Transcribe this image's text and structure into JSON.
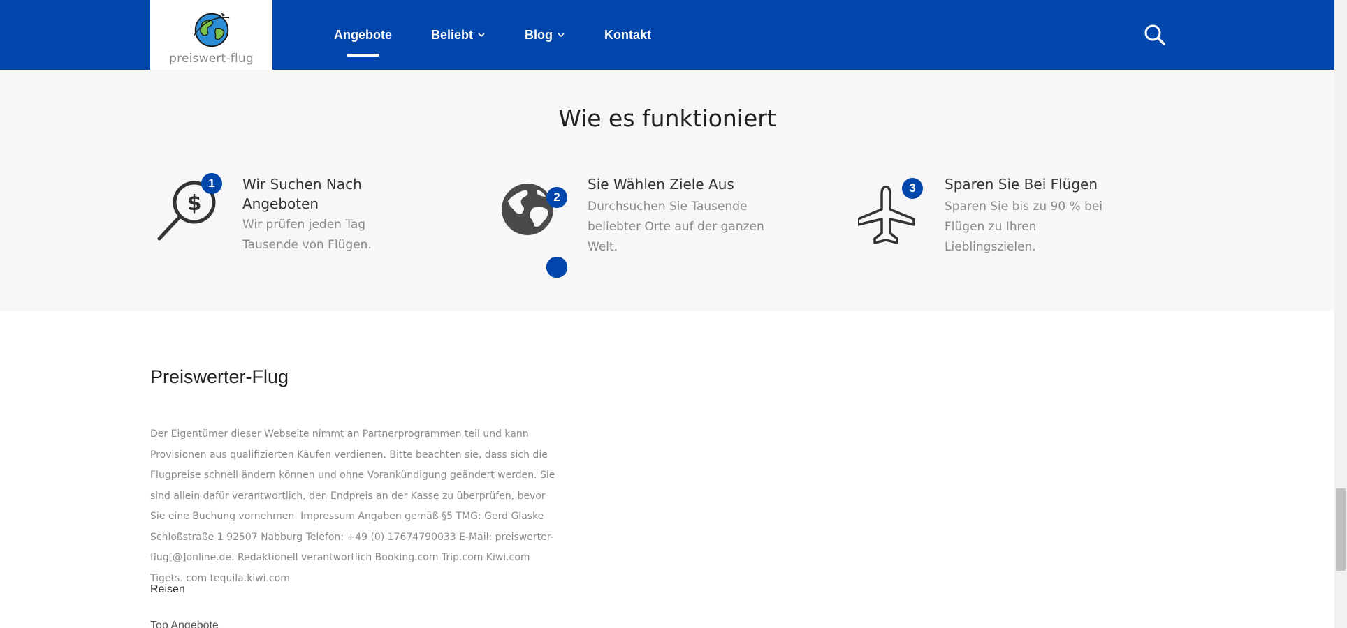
{
  "header": {
    "logo_text": "preiswert-flug",
    "nav": [
      {
        "label": "Angebote",
        "active": true,
        "dropdown": false
      },
      {
        "label": "Beliebt",
        "active": false,
        "dropdown": true
      },
      {
        "label": "Blog",
        "active": false,
        "dropdown": true
      },
      {
        "label": "Kontakt",
        "active": false,
        "dropdown": false
      }
    ],
    "search_icon": "search-icon",
    "brand_color": "#0046ab"
  },
  "how_it_works": {
    "title": "Wie es funktioniert",
    "steps": [
      {
        "number": "1",
        "icon": "search-dollar-icon",
        "title": "Wir Suchen Nach Angeboten",
        "description": "Wir prüfen jeden Tag Tausende von Flügen."
      },
      {
        "number": "2",
        "icon": "globe-icon",
        "title": "Sie Wählen Ziele Aus",
        "description": "Durchsuchen Sie Tausende beliebter Orte auf der ganzen Welt."
      },
      {
        "number": "3",
        "icon": "airplane-icon",
        "title": "Sparen Sie Bei Flügen",
        "description": "Sparen Sie bis zu 90 % bei Flügen zu Ihren Lieblingszielen."
      }
    ]
  },
  "footer": {
    "title": "Preiswerter-Flug",
    "body": "Der Eigentümer dieser Webseite nimmt an Partnerprogrammen teil und kann Provisionen aus qualifizierten Käufen verdienen. Bitte beachten sie, dass sich die Flugpreise schnell ändern können und ohne Vorankündigung geändert werden. Sie sind allein dafür verantwortlich, den Endpreis an der Kasse zu überprüfen, bevor Sie eine Buchung vornehmen. Impressum Angaben gemäß §5 TMG: Gerd Glaske Schloßstraße 1 92507 Nabburg Telefon: +49 (0) 17674790033 E-Mail: preiswerter-flug[@]online.de. Redaktionell verantwortlich Booking.com Trip.com Kiwi.com Tigets. com tequila.kiwi.com",
    "reisen_label": "Reisen",
    "top_label": "Top Angebote"
  }
}
